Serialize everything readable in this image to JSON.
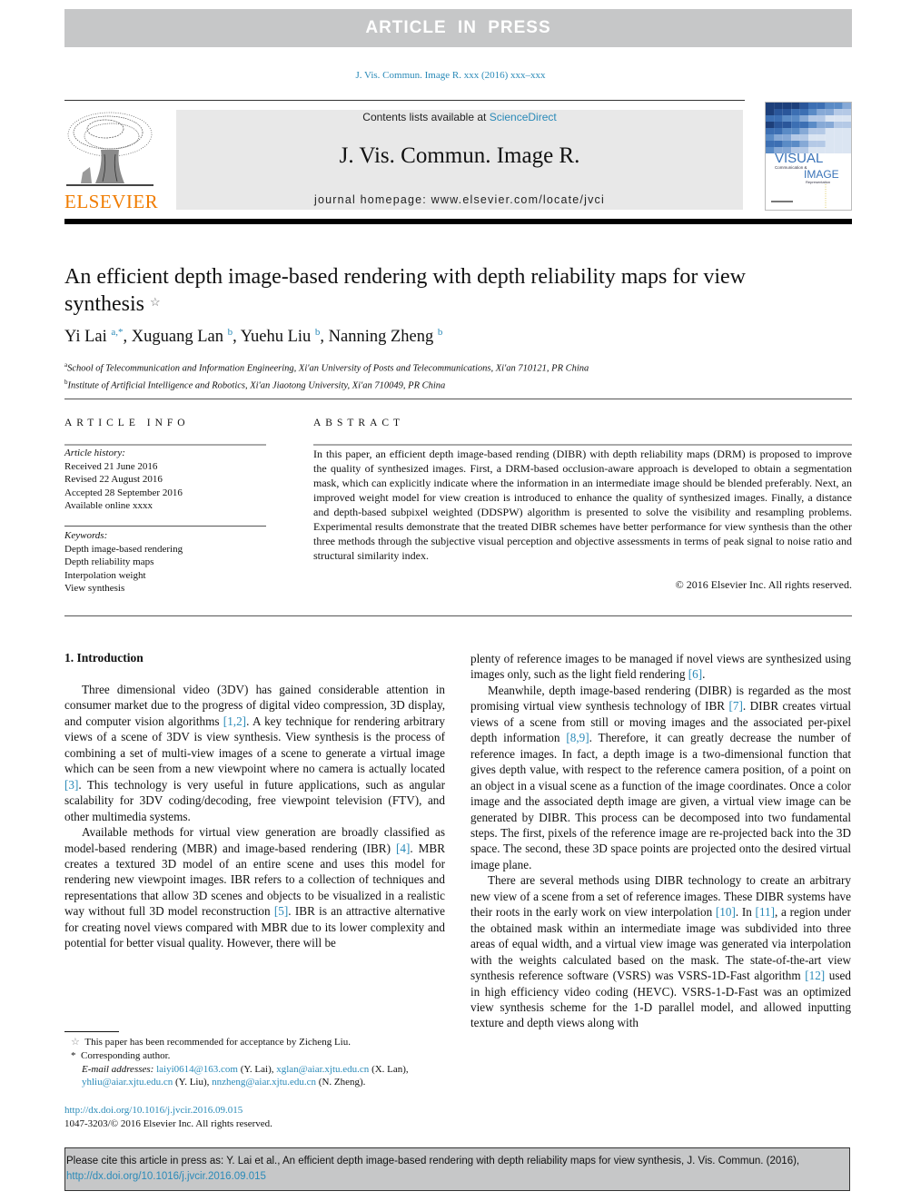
{
  "banner": {
    "text": "ARTICLE IN PRESS"
  },
  "journal_ref": "J. Vis. Commun. Image R. xxx (2016) xxx–xxx",
  "masthead": {
    "publisher_logo_word": "ELSEVIER",
    "contents_prefix": "Contents lists available at ",
    "contents_link": "ScienceDirect",
    "journal_title": "J. Vis. Commun. Image R.",
    "homepage_prefix": "journal homepage: ",
    "homepage_url": "www.elsevier.com/locate/jvci",
    "cover": {
      "line1": "VISUAL",
      "line2": "Communication &",
      "line3": "IMAGE",
      "line4": "Representation"
    }
  },
  "article": {
    "title": "An efficient depth image-based rendering with depth reliability maps for view synthesis",
    "title_mark": "☆",
    "authors": [
      {
        "name": "Yi Lai",
        "sup": "a,*",
        "sep": ", "
      },
      {
        "name": "Xuguang Lan",
        "sup": "b",
        "sep": ", "
      },
      {
        "name": "Yuehu Liu",
        "sup": "b",
        "sep": ", "
      },
      {
        "name": "Nanning Zheng",
        "sup": "b",
        "sep": ""
      }
    ],
    "affiliations": [
      {
        "mark": "a",
        "text": "School of Telecommunication and Information Engineering, Xi'an University of Posts and Telecommunications, Xi'an 710121, PR China"
      },
      {
        "mark": "b",
        "text": "Institute of Artificial Intelligence and Robotics, Xi'an Jiaotong University, Xi'an 710049, PR China"
      }
    ]
  },
  "article_info": {
    "heading": "ARTICLE INFO",
    "history_label": "Article history:",
    "history": [
      "Received 21 June 2016",
      "Revised 22 August 2016",
      "Accepted 28 September 2016",
      "Available online xxxx"
    ],
    "keywords_label": "Keywords:",
    "keywords": [
      "Depth image-based rendering",
      "Depth reliability maps",
      "Interpolation weight",
      "View synthesis"
    ]
  },
  "abstract": {
    "heading": "ABSTRACT",
    "text": "In this paper, an efficient depth image-based rending (DIBR) with depth reliability maps (DRM) is proposed to improve the quality of synthesized images. First, a DRM-based occlusion-aware approach is developed to obtain a segmentation mask, which can explicitly indicate where the information in an intermediate image should be blended preferably. Next, an improved weight model for view creation is introduced to enhance the quality of synthesized images. Finally, a distance and depth-based subpixel weighted (DDSPW) algorithm is presented to solve the visibility and resampling problems. Experimental results demonstrate that the treated DIBR schemes have better performance for view synthesis than the other three methods through the subjective visual perception and objective assessments in terms of peak signal to noise ratio and structural similarity index.",
    "copyright": "© 2016 Elsevier Inc. All rights reserved."
  },
  "body": {
    "section_heading": "1. Introduction",
    "left_paragraphs": [
      [
        {
          "t": "Three dimensional video (3DV) has gained considerable attention in consumer market due to the progress of digital video compression, 3D display, and computer vision algorithms "
        },
        {
          "ref": "[1,2]"
        },
        {
          "t": ". A key technique for rendering arbitrary views of a scene of 3DV is view synthesis. View synthesis is the process of combining a set of multi-view images of a scene to generate a virtual image which can be seen from a new viewpoint where no camera is actually located "
        },
        {
          "ref": "[3]"
        },
        {
          "t": ". This technology is very useful in future applications, such as angular scalability for 3DV coding/decoding, free viewpoint television (FTV), and other multimedia systems."
        }
      ],
      [
        {
          "t": "Available methods for virtual view generation are broadly classified as model-based rendering (MBR) and image-based rendering (IBR) "
        },
        {
          "ref": "[4]"
        },
        {
          "t": ". MBR creates a textured 3D model of an entire scene and uses this model for rendering new viewpoint images. IBR refers to a collection of techniques and representations that allow 3D scenes and objects to be visualized in a realistic way without full 3D model reconstruction "
        },
        {
          "ref": "[5]"
        },
        {
          "t": ". IBR is an attractive alternative for creating novel views compared with MBR due to its lower complexity and potential for better visual quality. However, there will be"
        }
      ]
    ],
    "right_paragraphs": [
      [
        {
          "t": "plenty of reference images to be managed if novel views are synthesized using images only, such as the light field rendering "
        },
        {
          "ref": "[6]"
        },
        {
          "t": "."
        }
      ],
      [
        {
          "t": "Meanwhile, depth image-based rendering (DIBR) is regarded as the most promising virtual view synthesis technology of IBR "
        },
        {
          "ref": "[7]"
        },
        {
          "t": ". DIBR creates virtual views of a scene from still or moving images and the associated per-pixel depth information "
        },
        {
          "ref": "[8,9]"
        },
        {
          "t": ". Therefore, it can greatly decrease the number of reference images. In fact, a depth image is a two-dimensional function that gives depth value, with respect to the reference camera position, of a point on an object in a visual scene as a function of the image coordinates. Once a color image and the associated depth image are given, a virtual view image can be generated by DIBR. This process can be decomposed into two fundamental steps. The first, pixels of the reference image are re-projected back into the 3D space. The second, these 3D space points are projected onto the desired virtual image plane."
        }
      ],
      [
        {
          "t": "There are several methods using DIBR technology to create an arbitrary new view of a scene from a set of reference images. These DIBR systems have their roots in the early work on view interpolation "
        },
        {
          "ref": "[10]"
        },
        {
          "t": ". In "
        },
        {
          "ref": "[11]"
        },
        {
          "t": ", a region under the obtained mask within an intermediate image was subdivided into three areas of equal width, and a virtual view image was generated via interpolation with the weights calculated based on the mask. The state-of-the-art view synthesis reference software (VSRS) was VSRS-1D-Fast algorithm "
        },
        {
          "ref": "[12]"
        },
        {
          "t": " used in high efficiency video coding (HEVC). VSRS-1-D-Fast was an optimized view synthesis scheme for the 1-D parallel model, and allowed inputting texture and depth views along with"
        }
      ]
    ]
  },
  "footnotes": {
    "recommendation": "This paper has been recommended for acceptance by Zicheng Liu.",
    "recommendation_mark": "☆",
    "corresponding": "Corresponding author.",
    "corresponding_mark": "*",
    "email_label": "E-mail addresses:",
    "emails": [
      {
        "addr": "laiyi0614@163.com",
        "who": " (Y. Lai), "
      },
      {
        "addr": "xglan@aiar.xjtu.edu.cn",
        "who": " (X. Lan), "
      },
      {
        "addr": "yhliu@aiar.xjtu.edu.cn",
        "who": " (Y. Liu), "
      },
      {
        "addr": "nnzheng@aiar.xjtu.edu.cn",
        "who": " (N. Zheng)."
      }
    ],
    "doi": "http://dx.doi.org/10.1016/j.jvcir.2016.09.015",
    "issn_line": "1047-3203/© 2016 Elsevier Inc. All rights reserved."
  },
  "cite_box": {
    "text": "Please cite this article in press as: Y. Lai et al., An efficient depth image-based rendering with depth reliability maps for view synthesis, J. Vis. Commun. (2016), ",
    "link": "http://dx.doi.org/10.1016/j.jvcir.2016.09.015"
  },
  "colors": {
    "link": "#2a8ab8",
    "banner": "#c6c7c8",
    "elsevier_orange": "#f07c00",
    "masthead_bg": "#e8e8e8"
  }
}
